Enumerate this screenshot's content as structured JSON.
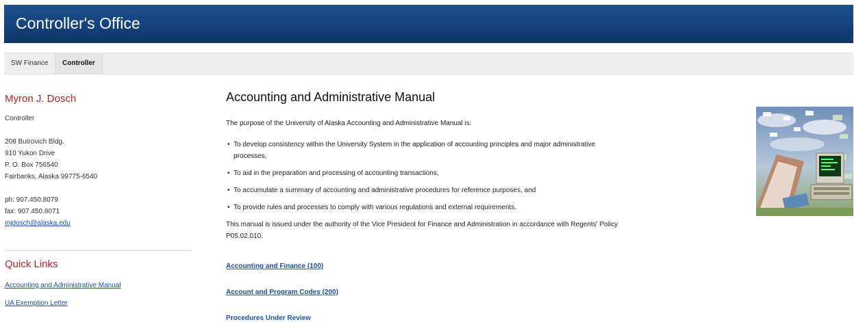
{
  "header": {
    "title": "Controller's Office"
  },
  "nav": {
    "items": [
      {
        "label": "SW Finance"
      },
      {
        "label": "Controller"
      }
    ]
  },
  "sidebar": {
    "name": "Myron J. Dosch",
    "role": "Controller",
    "address": [
      "208 Butrovich Bldg.",
      "910 Yukon Drive",
      "P. O. Box 756540",
      "Fairbanks, Alaska 99775-6540"
    ],
    "phone": "ph: 907.450.8079",
    "fax": "fax: 907.450.8071",
    "email": "mjdosch@alaska.edu",
    "quick_links_title": "Quick Links",
    "quick_links": [
      "Accounting and Administrative Manual",
      "UA Exemption Letter"
    ]
  },
  "main": {
    "title": "Accounting and Administrative Manual",
    "intro": "The purpose of the University of Alaska Accounting and Administrative Manual is:",
    "bullets": [
      "To develop consistency within the University System in the application of accounting principles and major administrative processes,",
      "To aid in the preparation and processing of accounting transactions,",
      "To accumulate a summary of accounting and administrative procedures for reference purposes, and",
      "To provide rules and processes to comply with various regulations and external requirements."
    ],
    "authority": "This manual is issued under the authority of the Vice President for Finance and Administration in accordance with Regents' Policy P05.02.010.",
    "links": [
      "Accounting and Finance (100)",
      "Account and Program Codes (200)",
      "Procedures Under Review"
    ]
  },
  "illustration": {
    "name": "accounting-collage"
  }
}
